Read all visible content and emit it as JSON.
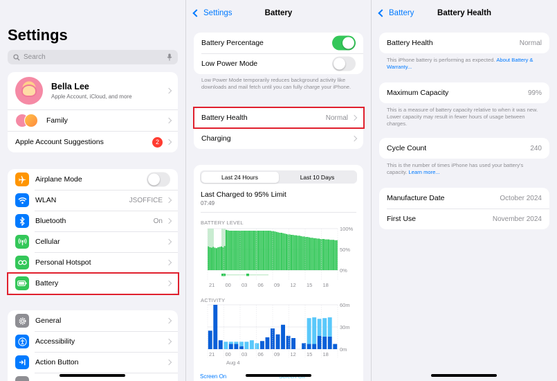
{
  "settings": {
    "title": "Settings",
    "search_placeholder": "Search",
    "profile": {
      "name": "Bella Lee",
      "subtitle": "Apple Account, iCloud, and more"
    },
    "family_label": "Family",
    "suggestions_label": "Apple Account Suggestions",
    "suggestions_badge": "2",
    "items": [
      {
        "label": "Airplane Mode",
        "value": "",
        "icon": "airplane-icon",
        "color": "#ff9500"
      },
      {
        "label": "WLAN",
        "value": "JSOFFICE",
        "icon": "wifi-icon",
        "color": "#007aff"
      },
      {
        "label": "Bluetooth",
        "value": "On",
        "icon": "bluetooth-icon",
        "color": "#007aff"
      },
      {
        "label": "Cellular",
        "value": "",
        "icon": "antenna-icon",
        "color": "#34c759"
      },
      {
        "label": "Personal Hotspot",
        "value": "",
        "icon": "hotspot-icon",
        "color": "#34c759"
      },
      {
        "label": "Battery",
        "value": "",
        "icon": "battery-icon",
        "color": "#34c759"
      }
    ],
    "items2": [
      {
        "label": "General",
        "icon": "gear-icon",
        "color": "#8e8e93"
      },
      {
        "label": "Accessibility",
        "icon": "accessibility-icon",
        "color": "#007aff"
      },
      {
        "label": "Action Button",
        "icon": "action-button-icon",
        "color": "#007aff"
      }
    ]
  },
  "battery": {
    "back_label": "Settings",
    "title": "Battery",
    "percentage_label": "Battery Percentage",
    "percentage_on": true,
    "low_power_label": "Low Power Mode",
    "low_power_on": false,
    "low_power_footer": "Low Power Mode temporarily reduces background activity like downloads and mail fetch until you can fully charge your iPhone.",
    "health_label": "Battery Health",
    "health_value": "Normal",
    "charging_label": "Charging",
    "segments": [
      "Last 24 Hours",
      "Last 10 Days"
    ],
    "selected_segment": "Last 24 Hours",
    "last_charged": "Last Charged to 95% Limit",
    "last_charged_time": "07:49",
    "level_heading": "BATTERY LEVEL",
    "activity_heading": "ACTIVITY",
    "screen_on_label": "Screen On",
    "screen_off_label": "Screen Off",
    "colors": {
      "green": "#34c759",
      "dark_blue": "#0a5fd8",
      "light_blue": "#5ac8fa",
      "light_green": "#c9ecd1"
    }
  },
  "chart_data": [
    {
      "type": "bar",
      "name": "BATTERY LEVEL",
      "x_tick_labels": [
        "21",
        "00",
        "03",
        "06",
        "09",
        "12",
        "15",
        "18"
      ],
      "y_tick_labels": [
        "100%",
        "50%",
        "0%"
      ],
      "ylim": [
        0,
        100
      ],
      "values": [
        57,
        55,
        54,
        56,
        54,
        53,
        55,
        56,
        57,
        55,
        58,
        97,
        96,
        95,
        95,
        95,
        95,
        95,
        95,
        95,
        95,
        95,
        95,
        95,
        95,
        95,
        95,
        95,
        95,
        95,
        95,
        95,
        95,
        95,
        95,
        95,
        95,
        95,
        95,
        94,
        94,
        93,
        92,
        91,
        90,
        90,
        89,
        88,
        87,
        86,
        86,
        85,
        85,
        84,
        84,
        83,
        83,
        82,
        81,
        81,
        80,
        80,
        79,
        78,
        78,
        77,
        77,
        76,
        76,
        75,
        75,
        75,
        74,
        74,
        74,
        73,
        73,
        73,
        72,
        72
      ]
    },
    {
      "type": "bar",
      "name": "ACTIVITY",
      "x_tick_labels": [
        "21",
        "00",
        "03",
        "06",
        "09",
        "12",
        "15",
        "18"
      ],
      "x_sub_label": "Aug 4",
      "y_tick_labels": [
        "60m",
        "30m",
        "0m"
      ],
      "ylim": [
        0,
        60
      ],
      "series": [
        {
          "name": "Screen On",
          "values": [
            25,
            60,
            12,
            0,
            7,
            7,
            4,
            0,
            0,
            0,
            11,
            16,
            28,
            20,
            33,
            18,
            15,
            0,
            8,
            7,
            7,
            18,
            17,
            17,
            7
          ]
        },
        {
          "name": "Screen Off",
          "values": [
            0,
            0,
            0,
            10,
            3,
            3,
            6,
            10,
            12,
            8,
            0,
            0,
            0,
            0,
            0,
            0,
            0,
            0,
            0,
            35,
            36,
            23,
            25,
            26,
            0
          ]
        }
      ]
    }
  ],
  "health": {
    "back_label": "Battery",
    "title": "Battery Health",
    "health_label": "Battery Health",
    "health_value": "Normal",
    "health_footer": "This iPhone battery is performing as expected.",
    "health_footer_link": "About Battery & Warranty...",
    "capacity_label": "Maximum Capacity",
    "capacity_value": "99%",
    "capacity_footer": "This is a measure of battery capacity relative to when it was new. Lower capacity may result in fewer hours of usage between charges.",
    "cycle_label": "Cycle Count",
    "cycle_value": "240",
    "cycle_footer": "This is the number of times iPhone has used your battery's capacity.",
    "cycle_footer_link": "Learn more...",
    "manufacture_label": "Manufacture Date",
    "manufacture_value": "October 2024",
    "first_use_label": "First Use",
    "first_use_value": "November 2024"
  }
}
